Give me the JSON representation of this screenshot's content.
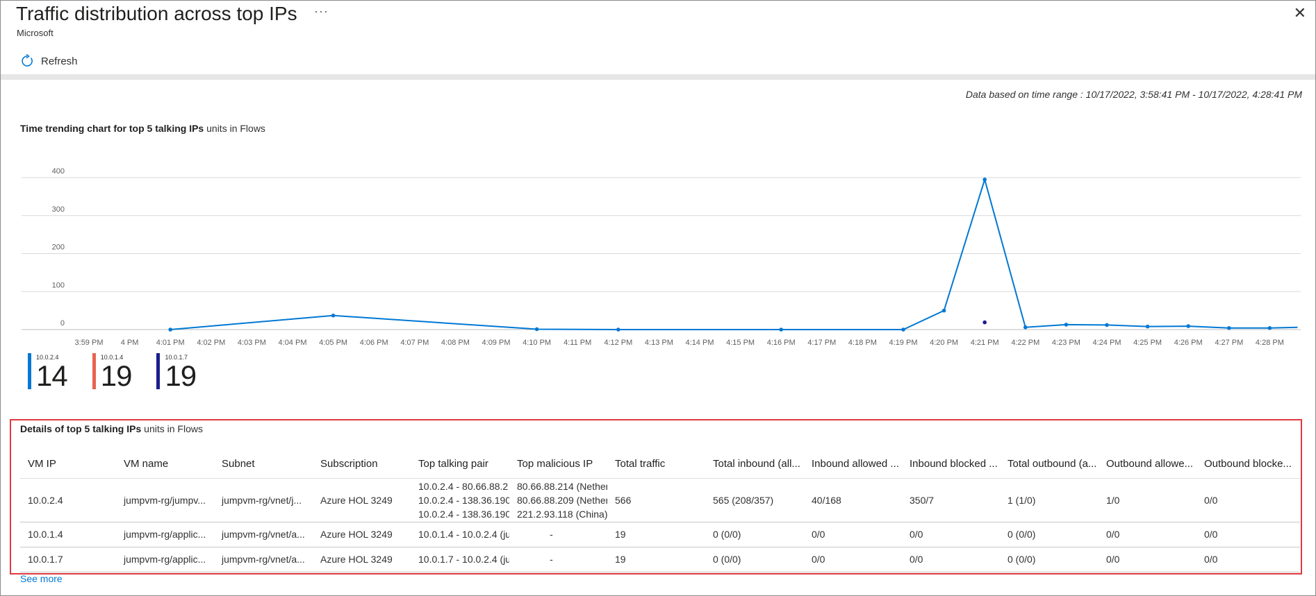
{
  "header": {
    "title": "Traffic distribution across top IPs",
    "more_label": "···",
    "subtitle": "Microsoft",
    "close_label": "✕"
  },
  "toolbar": {
    "refresh_label": "Refresh"
  },
  "time_range": "Data based on time range : 10/17/2022, 3:58:41 PM - 10/17/2022, 4:28:41 PM",
  "chart_section": {
    "title_bold": "Time trending chart for top 5 talking IPs",
    "units": "units in Flows"
  },
  "colors": {
    "series_main": "#0078d4",
    "series_red": "#e8634f",
    "series_navy": "#1a1f8c",
    "grid": "#d9d9d9",
    "highlight_border": "#e0393e",
    "link": "#0078d4"
  },
  "chart_data": {
    "type": "line",
    "yticks": [
      0,
      100,
      200,
      300,
      400
    ],
    "ylim": [
      0,
      400
    ],
    "xticks": [
      "3:59 PM",
      "4 PM",
      "4:01 PM",
      "4:02 PM",
      "4:03 PM",
      "4:04 PM",
      "4:05 PM",
      "4:06 PM",
      "4:07 PM",
      "4:08 PM",
      "4:09 PM",
      "4:10 PM",
      "4:11 PM",
      "4:12 PM",
      "4:13 PM",
      "4:14 PM",
      "4:15 PM",
      "4:16 PM",
      "4:17 PM",
      "4:18 PM",
      "4:19 PM",
      "4:20 PM",
      "4:21 PM",
      "4:22 PM",
      "4:23 PM",
      "4:24 PM",
      "4:25 PM",
      "4:26 PM",
      "4:27 PM",
      "4:28 PM"
    ],
    "series": [
      {
        "name": "10.0.2.4",
        "color": "#0078d4",
        "points": [
          {
            "x": "4:01 PM",
            "y": 0
          },
          {
            "x": "4:05 PM",
            "y": 37
          },
          {
            "x": "4:10 PM",
            "y": 1
          },
          {
            "x": "4:12 PM",
            "y": 0
          },
          {
            "x": "4:16 PM",
            "y": 0
          },
          {
            "x": "4:19 PM",
            "y": 0
          },
          {
            "x": "4:20 PM",
            "y": 50
          },
          {
            "x": "4:21 PM",
            "y": 395
          },
          {
            "x": "4:22 PM",
            "y": 6
          },
          {
            "x": "4:23 PM",
            "y": 13
          },
          {
            "x": "4:24 PM",
            "y": 12
          },
          {
            "x": "4:25 PM",
            "y": 8
          },
          {
            "x": "4:26 PM",
            "y": 9
          },
          {
            "x": "4:27 PM",
            "y": 4
          },
          {
            "x": "4:28 PM",
            "y": 4
          },
          {
            "x": "4:28:41 PM",
            "y": 6
          }
        ]
      },
      {
        "name": "10.0.1.7",
        "color": "#1a1f8c",
        "points": [
          {
            "x": "4:21 PM",
            "y": 19
          }
        ]
      }
    ]
  },
  "legend": [
    {
      "ip": "10.0.2.4",
      "value": "14",
      "color": "#0078d4"
    },
    {
      "ip": "10.0.1.4",
      "value": "19",
      "color": "#e8634f"
    },
    {
      "ip": "10.0.1.7",
      "value": "19",
      "color": "#1a1f8c"
    }
  ],
  "details": {
    "title_bold": "Details of top 5 talking IPs",
    "units": "units in Flows",
    "columns": [
      "VM IP",
      "VM name",
      "Subnet",
      "Subscription",
      "Top talking pair",
      "Top malicious IP",
      "Total traffic",
      "Total inbound (all...",
      "Inbound allowed ...",
      "Inbound blocked ...",
      "Total outbound (a...",
      "Outbound allowe...",
      "Outbound blocke..."
    ],
    "rows": [
      {
        "vm_ip": "10.0.2.4",
        "vm_name": "jumpvm-rg/jumpv...",
        "subnet": "jumpvm-rg/vnet/j...",
        "subscription": "Azure HOL 3249",
        "pairs": [
          "10.0.2.4 - 80.66.88.2",
          "10.0.2.4 - 138.36.190",
          "10.0.2.4 - 138.36.190"
        ],
        "malicious": [
          "80.66.88.214 (Nether",
          "80.66.88.209 (Nether",
          "221.2.93.118 (China)"
        ],
        "total": "566",
        "in_total": "565 (208/357)",
        "in_allowed": "40/168",
        "in_blocked": "350/7",
        "out_total": "1 (1/0)",
        "out_allowed": "1/0",
        "out_blocked": "0/0"
      },
      {
        "vm_ip": "10.0.1.4",
        "vm_name": "jumpvm-rg/applic...",
        "subnet": "jumpvm-rg/vnet/a...",
        "subscription": "Azure HOL 3249",
        "pair": "10.0.1.4 - 10.0.2.4 (ju",
        "malicious": "-",
        "total": "19",
        "in_total": "0 (0/0)",
        "in_allowed": "0/0",
        "in_blocked": "0/0",
        "out_total": "0 (0/0)",
        "out_allowed": "0/0",
        "out_blocked": "0/0"
      },
      {
        "vm_ip": "10.0.1.7",
        "vm_name": "jumpvm-rg/applic...",
        "subnet": "jumpvm-rg/vnet/a...",
        "subscription": "Azure HOL 3249",
        "pair": "10.0.1.7 - 10.0.2.4 (ju",
        "malicious": "-",
        "total": "19",
        "in_total": "0 (0/0)",
        "in_allowed": "0/0",
        "in_blocked": "0/0",
        "out_total": "0 (0/0)",
        "out_allowed": "0/0",
        "out_blocked": "0/0"
      }
    ],
    "see_more": "See more"
  }
}
